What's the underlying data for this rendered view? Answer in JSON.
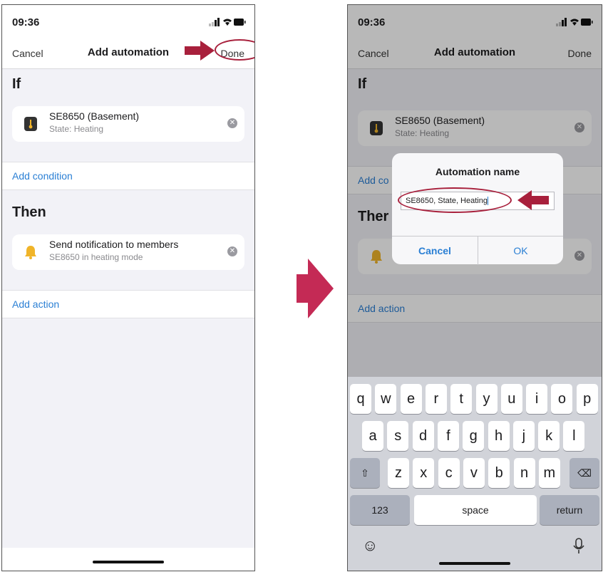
{
  "left_screen": {
    "status": {
      "time": "09:36"
    },
    "nav": {
      "cancel": "Cancel",
      "title": "Add automation",
      "done": "Done"
    },
    "if_section": {
      "heading": "If",
      "item": {
        "title": "SE8650 (Basement)",
        "subtitle": "State: Heating",
        "icon": "thermostat-icon"
      }
    },
    "add_condition": "Add condition",
    "then_section": {
      "heading": "Then",
      "item": {
        "title": "Send notification to members",
        "subtitle": "SE8650 in heating mode",
        "icon": "bell-icon"
      }
    },
    "add_action": "Add action"
  },
  "right_screen": {
    "status": {
      "time": "09:36"
    },
    "nav": {
      "cancel": "Cancel",
      "title": "Add automation",
      "done": "Done"
    },
    "if_section": {
      "heading": "If",
      "item": {
        "title": "SE8650 (Basement)",
        "subtitle": "State: Heating"
      }
    },
    "add_condition_partial": "Add co",
    "then_partial": "Ther",
    "add_action": "Add action",
    "dialog": {
      "title": "Automation name",
      "input_value": "SE8650, State, Heating",
      "cancel": "Cancel",
      "ok": "OK"
    },
    "keyboard": {
      "row1": [
        "q",
        "w",
        "e",
        "r",
        "t",
        "y",
        "u",
        "i",
        "o",
        "p"
      ],
      "row2": [
        "a",
        "s",
        "d",
        "f",
        "g",
        "h",
        "j",
        "k",
        "l"
      ],
      "row3": [
        "z",
        "x",
        "c",
        "v",
        "b",
        "n",
        "m"
      ],
      "numbers_key": "123",
      "space_key": "space",
      "return_key": "return"
    }
  },
  "colors": {
    "accent": "#2a7fd4",
    "annotation": "#a8203c",
    "bell": "#f0b429"
  }
}
